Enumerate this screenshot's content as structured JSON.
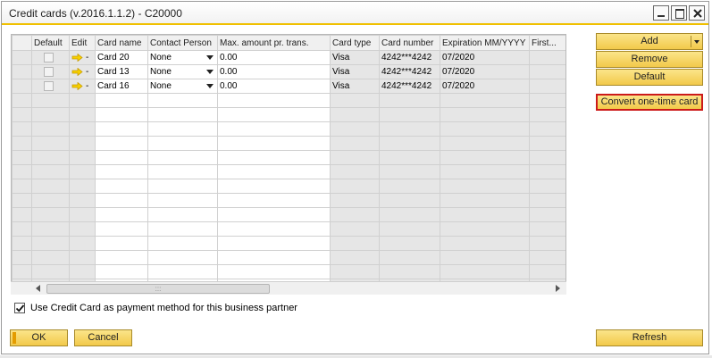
{
  "window": {
    "title": "Credit cards (v.2016.1.1.2) - C20000"
  },
  "grid": {
    "columns": [
      "",
      "Default",
      "Edit",
      "Card name",
      "Contact Person",
      "Max. amount pr. trans.",
      "Card type",
      "Card number",
      "Expiration MM/YYYY",
      "First..."
    ],
    "rows": [
      {
        "edit_dash": "-",
        "card_name": "Card 20",
        "contact": "None",
        "max_amount": "0.00",
        "card_type": "Visa",
        "card_number": "4242***4242",
        "expiration": "07/2020"
      },
      {
        "edit_dash": "-",
        "card_name": "Card 13",
        "contact": "None",
        "max_amount": "0.00",
        "card_type": "Visa",
        "card_number": "4242***4242",
        "expiration": "07/2020"
      },
      {
        "edit_dash": "-",
        "card_name": "Card 16",
        "contact": "None",
        "max_amount": "0.00",
        "card_type": "Visa",
        "card_number": "4242***4242",
        "expiration": "07/2020"
      }
    ],
    "scroll_thumb_grip": ":::"
  },
  "side_buttons": {
    "add": "Add",
    "remove": "Remove",
    "default": "Default",
    "convert": "Convert one-time card"
  },
  "checkbox": {
    "label": "Use Credit Card as payment method for this business partner",
    "checked": true
  },
  "footer": {
    "ok": "OK",
    "cancel": "Cancel",
    "refresh": "Refresh"
  },
  "colors": {
    "accent": "#f0c000",
    "button": "#f6d36a",
    "highlight_border": "#cc1a1a",
    "arrow_icon": "#f2c300"
  },
  "icons": {
    "edit_link": "arrow-right-icon",
    "checkmark": "check-icon"
  }
}
